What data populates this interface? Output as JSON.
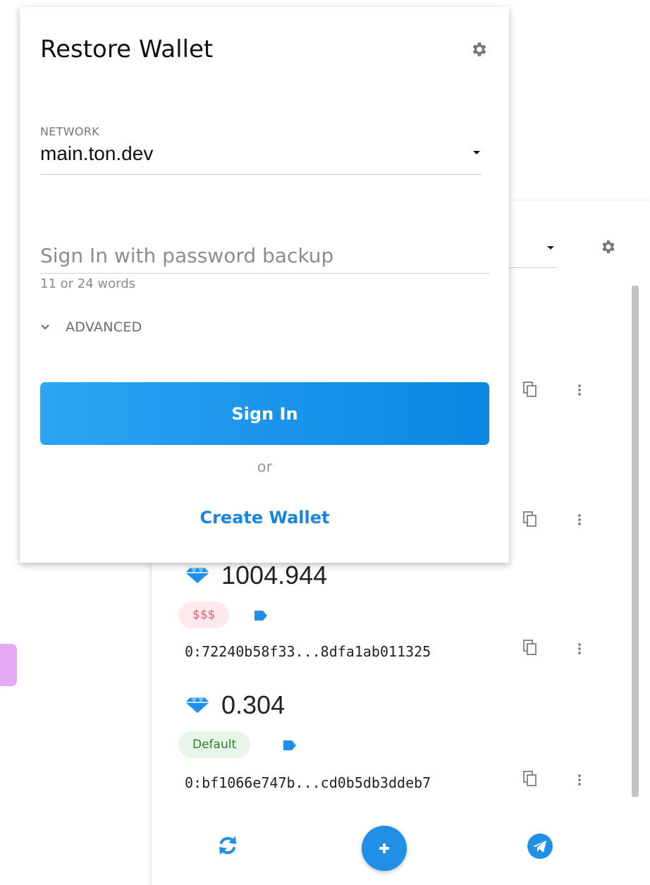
{
  "restore_card": {
    "title": "Restore Wallet",
    "settings_icon": "gear-icon",
    "network": {
      "label": "NETWORK",
      "value": "main.ton.dev"
    },
    "password_backup": {
      "placeholder": "Sign In with password backup",
      "hint": "11 or 24 words"
    },
    "advanced_label": "ADVANCED",
    "sign_in_label": "Sign In",
    "or_label": "or",
    "create_wallet_label": "Create Wallet"
  },
  "wallet_list": {
    "settings_icon": "gear-icon",
    "accounts": [
      {
        "balance": "1004.944",
        "badge": "$$$",
        "badge_style": "danger",
        "address": "0:72240b58f33...8dfa1ab011325"
      },
      {
        "balance": "0.304",
        "badge": "Default",
        "badge_style": "default",
        "address": "0:bf1066e747b...cd0b5db3ddeb7"
      }
    ],
    "bottom_actions": [
      "refresh-icon",
      "add-icon",
      "telegram-icon"
    ]
  },
  "colors": {
    "accent": "#1f8fe8",
    "button_gradient_start": "#2aa5f4",
    "button_gradient_end": "#0b86e2",
    "danger_badge_bg": "#fdeaed",
    "danger_badge_text": "#f25a6f",
    "default_badge_bg": "#e8f5e9",
    "default_badge_text": "#2e7d32",
    "side_block": "#e6a8f3"
  }
}
